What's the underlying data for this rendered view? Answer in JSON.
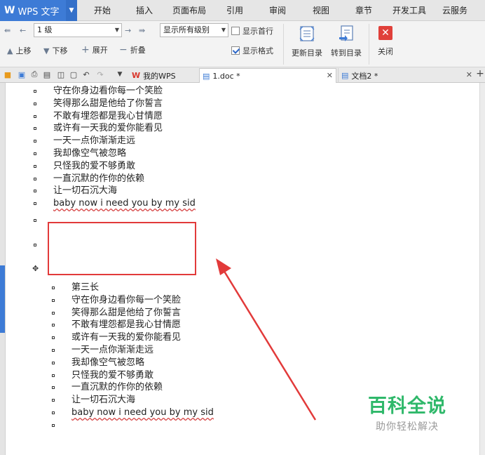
{
  "app": {
    "logo": "W",
    "title": "WPS 文字"
  },
  "menu": [
    "开始",
    "插入",
    "页面布局",
    "引用",
    "审阅",
    "视图",
    "章节",
    "开发工具",
    "云服务"
  ],
  "ribbon": {
    "level_select": "1 级",
    "show_levels_select": "显示所有级别",
    "show_first_line": "显示首行",
    "show_format": "显示格式",
    "move_up": "上移",
    "move_down": "下移",
    "expand": "展开",
    "collapse": "折叠",
    "update_toc": "更新目录",
    "goto_toc": "转到目录",
    "close": "关闭"
  },
  "tabs": [
    {
      "label": "我的WPS"
    },
    {
      "label": "1.doc *"
    },
    {
      "label": "文档2 *"
    }
  ],
  "doc": {
    "block1": [
      "守在你身边看你每一个笑脸",
      "笑得那么甜是他给了你誓言",
      "不敢有埋怨都是我心甘情愿",
      "或许有一天我的爱你能看见",
      "一天一点你渐渐走远",
      "我却像空气被忽略",
      "只怪我的爱不够勇敢",
      "一直沉默的作你的依赖",
      "让一切石沉大海",
      "baby now i need you by my sid"
    ],
    "block2": [
      "第三长",
      "守在你身边看你每一个笑脸",
      "笑得那么甜是他给了你誓言",
      "不敢有埋怨都是我心甘情愿",
      "或许有一天我的爱你能看见",
      "一天一点你渐渐走远",
      "我却像空气被忽略",
      "只怪我的爱不够勇敢",
      "一直沉默的作你的依赖",
      "让一切石沉大海",
      "baby now i need you by my sid"
    ]
  },
  "watermark": {
    "main": "百科全说",
    "sub": "助你轻松解决"
  },
  "colors": {
    "accent": "#3d7bd6",
    "highlight": "#e23a3a",
    "watermark": "#2fb86a"
  }
}
